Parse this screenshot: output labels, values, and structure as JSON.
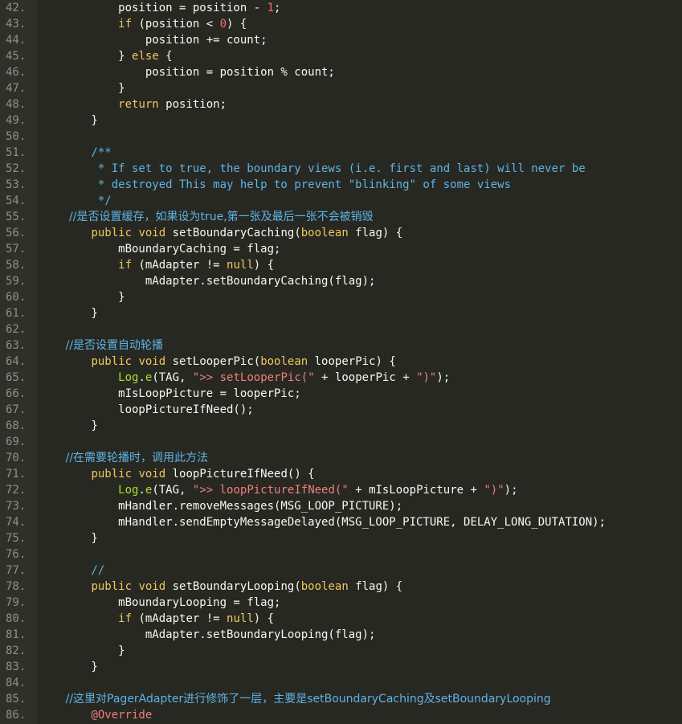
{
  "editor": {
    "line_numbers": [
      "42.",
      "43.",
      "44.",
      "45.",
      "46.",
      "47.",
      "48.",
      "49.",
      "50.",
      "51.",
      "52.",
      "53.",
      "54.",
      "55.",
      "56.",
      "57.",
      "58.",
      "59.",
      "60.",
      "61.",
      "62.",
      "63.",
      "64.",
      "65.",
      "66.",
      "67.",
      "68.",
      "69.",
      "70.",
      "71.",
      "72.",
      "73.",
      "74.",
      "75.",
      "76.",
      "77.",
      "78.",
      "79.",
      "80.",
      "81.",
      "82.",
      "83.",
      "84.",
      "85.",
      "86."
    ],
    "lines": [
      [
        {
          "t": "            position = position - ",
          "c": "plain"
        },
        {
          "t": "1",
          "c": "num"
        },
        {
          "t": ";",
          "c": "plain"
        }
      ],
      [
        {
          "t": "            ",
          "c": "plain"
        },
        {
          "t": "if",
          "c": "kw"
        },
        {
          "t": " (position < ",
          "c": "plain"
        },
        {
          "t": "0",
          "c": "num"
        },
        {
          "t": ") {",
          "c": "plain"
        }
      ],
      [
        {
          "t": "                position += count;",
          "c": "plain"
        }
      ],
      [
        {
          "t": "            } ",
          "c": "plain"
        },
        {
          "t": "else",
          "c": "kw"
        },
        {
          "t": " {",
          "c": "plain"
        }
      ],
      [
        {
          "t": "                position = position % count;",
          "c": "plain"
        }
      ],
      [
        {
          "t": "            }",
          "c": "plain"
        }
      ],
      [
        {
          "t": "            ",
          "c": "plain"
        },
        {
          "t": "return",
          "c": "kw"
        },
        {
          "t": " position;",
          "c": "plain"
        }
      ],
      [
        {
          "t": "        }",
          "c": "plain"
        }
      ],
      [
        {
          "t": "",
          "c": "plain"
        }
      ],
      [
        {
          "t": "        /**",
          "c": "cm"
        }
      ],
      [
        {
          "t": "         * If set to true, the boundary views (i.e. first and last) will never be",
          "c": "cm"
        }
      ],
      [
        {
          "t": "         * destroyed This may help to prevent \"blinking\" of some views",
          "c": "cm"
        }
      ],
      [
        {
          "t": "         */",
          "c": "cm"
        }
      ],
      [
        {
          "t": "         //是否设置缓存，如果设为true,第一张及最后一张不会被销毁",
          "c": "cm"
        }
      ],
      [
        {
          "t": "        ",
          "c": "plain"
        },
        {
          "t": "public",
          "c": "kw"
        },
        {
          "t": " ",
          "c": "plain"
        },
        {
          "t": "void",
          "c": "kw"
        },
        {
          "t": " setBoundaryCaching(",
          "c": "plain"
        },
        {
          "t": "boolean",
          "c": "ty"
        },
        {
          "t": " flag) {",
          "c": "plain"
        }
      ],
      [
        {
          "t": "            mBoundaryCaching = flag;",
          "c": "plain"
        }
      ],
      [
        {
          "t": "            ",
          "c": "plain"
        },
        {
          "t": "if",
          "c": "kw"
        },
        {
          "t": " (mAdapter != ",
          "c": "plain"
        },
        {
          "t": "null",
          "c": "kw"
        },
        {
          "t": ") {",
          "c": "plain"
        }
      ],
      [
        {
          "t": "                mAdapter.setBoundaryCaching(flag);",
          "c": "plain"
        }
      ],
      [
        {
          "t": "            }",
          "c": "plain"
        }
      ],
      [
        {
          "t": "        }",
          "c": "plain"
        }
      ],
      [
        {
          "t": "",
          "c": "plain"
        }
      ],
      [
        {
          "t": "        //是否设置自动轮播",
          "c": "cm"
        }
      ],
      [
        {
          "t": "        ",
          "c": "plain"
        },
        {
          "t": "public",
          "c": "kw"
        },
        {
          "t": " ",
          "c": "plain"
        },
        {
          "t": "void",
          "c": "kw"
        },
        {
          "t": " setLooperPic(",
          "c": "plain"
        },
        {
          "t": "boolean",
          "c": "ty"
        },
        {
          "t": " looperPic) {",
          "c": "plain"
        }
      ],
      [
        {
          "t": "            ",
          "c": "plain"
        },
        {
          "t": "Log",
          "c": "logc"
        },
        {
          "t": ".",
          "c": "plain"
        },
        {
          "t": "e",
          "c": "logc"
        },
        {
          "t": "(TAG, ",
          "c": "plain"
        },
        {
          "t": "\">> setLooperPic(\"",
          "c": "str"
        },
        {
          "t": " + looperPic + ",
          "c": "plain"
        },
        {
          "t": "\")\"",
          "c": "str"
        },
        {
          "t": ");",
          "c": "plain"
        }
      ],
      [
        {
          "t": "            mIsLoopPicture = looperPic;",
          "c": "plain"
        }
      ],
      [
        {
          "t": "            loopPictureIfNeed();",
          "c": "plain"
        }
      ],
      [
        {
          "t": "        }",
          "c": "plain"
        }
      ],
      [
        {
          "t": "",
          "c": "plain"
        }
      ],
      [
        {
          "t": "        //在需要轮播时，调用此方法",
          "c": "cm"
        }
      ],
      [
        {
          "t": "        ",
          "c": "plain"
        },
        {
          "t": "public",
          "c": "kw"
        },
        {
          "t": " ",
          "c": "plain"
        },
        {
          "t": "void",
          "c": "kw"
        },
        {
          "t": " loopPictureIfNeed() {",
          "c": "plain"
        }
      ],
      [
        {
          "t": "            ",
          "c": "plain"
        },
        {
          "t": "Log",
          "c": "logc"
        },
        {
          "t": ".",
          "c": "plain"
        },
        {
          "t": "e",
          "c": "logc"
        },
        {
          "t": "(TAG, ",
          "c": "plain"
        },
        {
          "t": "\">> loopPictureIfNeed(\"",
          "c": "str"
        },
        {
          "t": " + mIsLoopPicture + ",
          "c": "plain"
        },
        {
          "t": "\")\"",
          "c": "str"
        },
        {
          "t": ");",
          "c": "plain"
        }
      ],
      [
        {
          "t": "            mHandler.removeMessages(MSG_LOOP_PICTURE);",
          "c": "plain"
        }
      ],
      [
        {
          "t": "            mHandler.sendEmptyMessageDelayed(MSG_LOOP_PICTURE, DELAY_LONG_DUTATION);",
          "c": "plain"
        }
      ],
      [
        {
          "t": "        }",
          "c": "plain"
        }
      ],
      [
        {
          "t": "",
          "c": "plain"
        }
      ],
      [
        {
          "t": "        //",
          "c": "cm"
        }
      ],
      [
        {
          "t": "        ",
          "c": "plain"
        },
        {
          "t": "public",
          "c": "kw"
        },
        {
          "t": " ",
          "c": "plain"
        },
        {
          "t": "void",
          "c": "kw"
        },
        {
          "t": " setBoundaryLooping(",
          "c": "plain"
        },
        {
          "t": "boolean",
          "c": "ty"
        },
        {
          "t": " flag) {",
          "c": "plain"
        }
      ],
      [
        {
          "t": "            mBoundaryLooping = flag;",
          "c": "plain"
        }
      ],
      [
        {
          "t": "            ",
          "c": "plain"
        },
        {
          "t": "if",
          "c": "kw"
        },
        {
          "t": " (mAdapter != ",
          "c": "plain"
        },
        {
          "t": "null",
          "c": "kw"
        },
        {
          "t": ") {",
          "c": "plain"
        }
      ],
      [
        {
          "t": "                mAdapter.setBoundaryLooping(flag);",
          "c": "plain"
        }
      ],
      [
        {
          "t": "            }",
          "c": "plain"
        }
      ],
      [
        {
          "t": "        }",
          "c": "plain"
        }
      ],
      [
        {
          "t": "",
          "c": "plain"
        }
      ],
      [
        {
          "t": "        //这里对PagerAdapter进行修饰了一层，主要是setBoundaryCaching及setBoundaryLooping",
          "c": "cm"
        }
      ],
      [
        {
          "t": "        @Override",
          "c": "an"
        }
      ]
    ]
  },
  "colors": {
    "background": "#272822",
    "gutter": "#2f302a",
    "line_number": "#8f908a",
    "keyword": "#f0c75e",
    "number": "#ff6b6b",
    "string": "#f07f7f",
    "comment": "#5fb3e6",
    "log_call": "#a6e22e",
    "text": "#f8f8f2"
  }
}
